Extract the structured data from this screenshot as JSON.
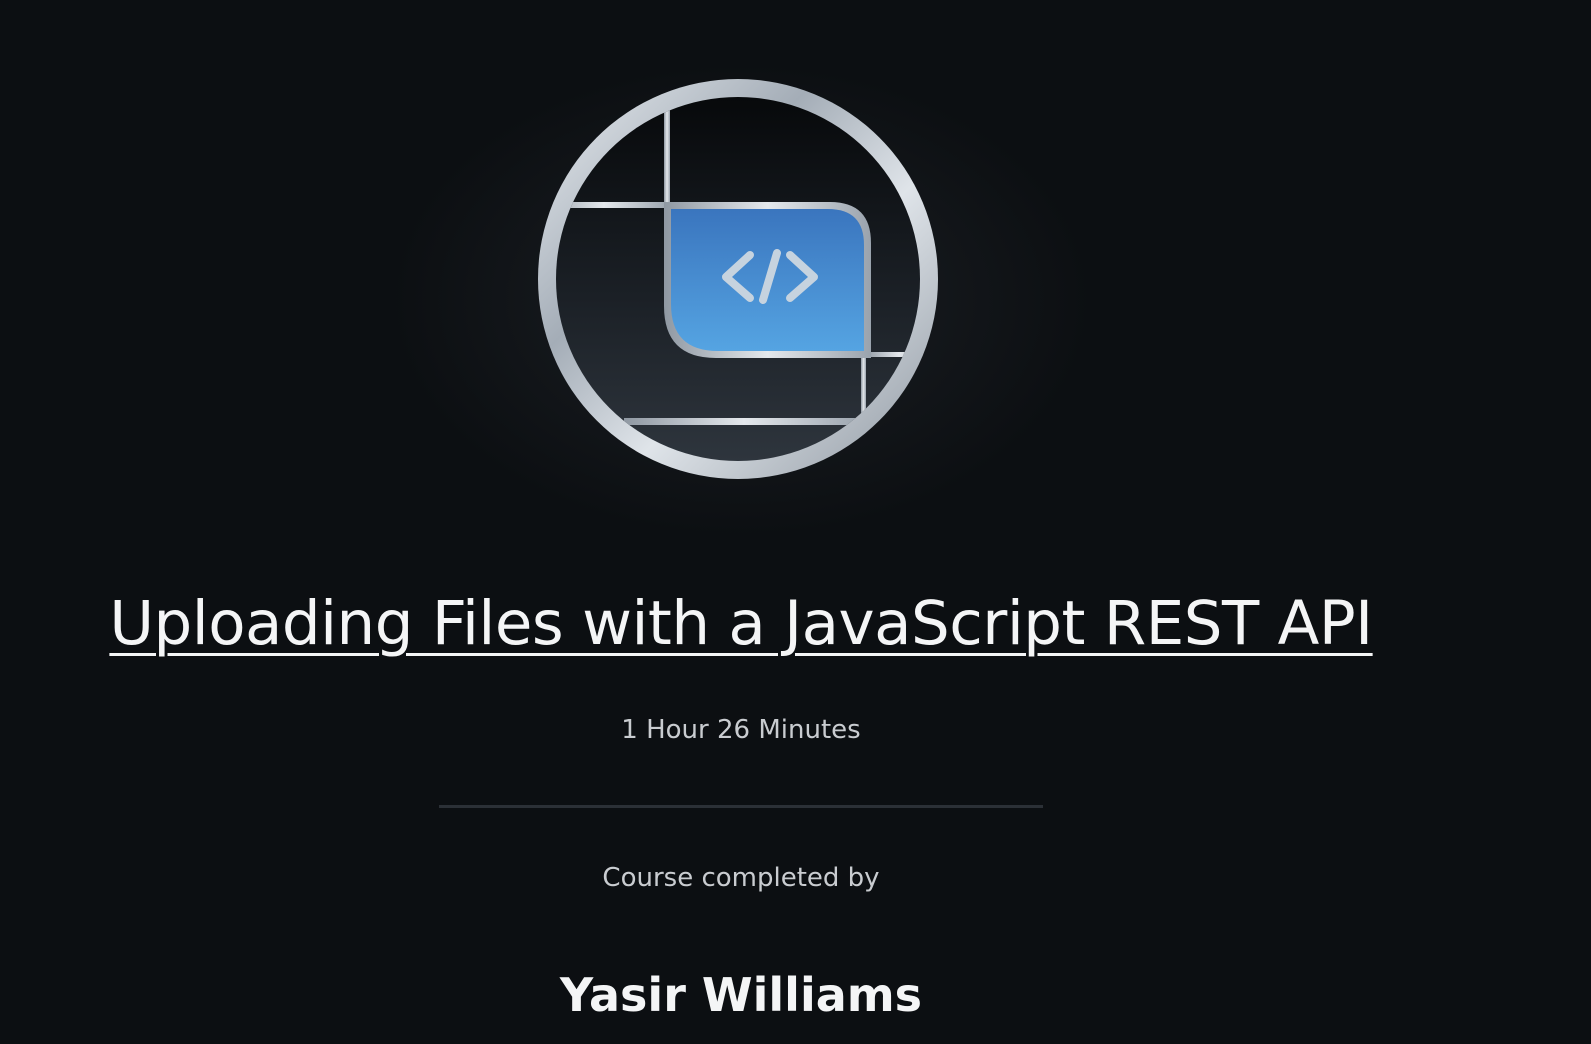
{
  "certificate": {
    "course_title": "Uploading Files with a JavaScript REST API",
    "duration": "1 Hour 26 Minutes",
    "completed_label": "Course completed by",
    "recipient_name": "Yasir Williams",
    "badge_icon": "code-brackets-icon"
  },
  "colors": {
    "background": "#0c0f12",
    "badge_accent": "#3f86d1",
    "text_primary": "#f4f5f6",
    "text_secondary": "#c9ccd0"
  }
}
